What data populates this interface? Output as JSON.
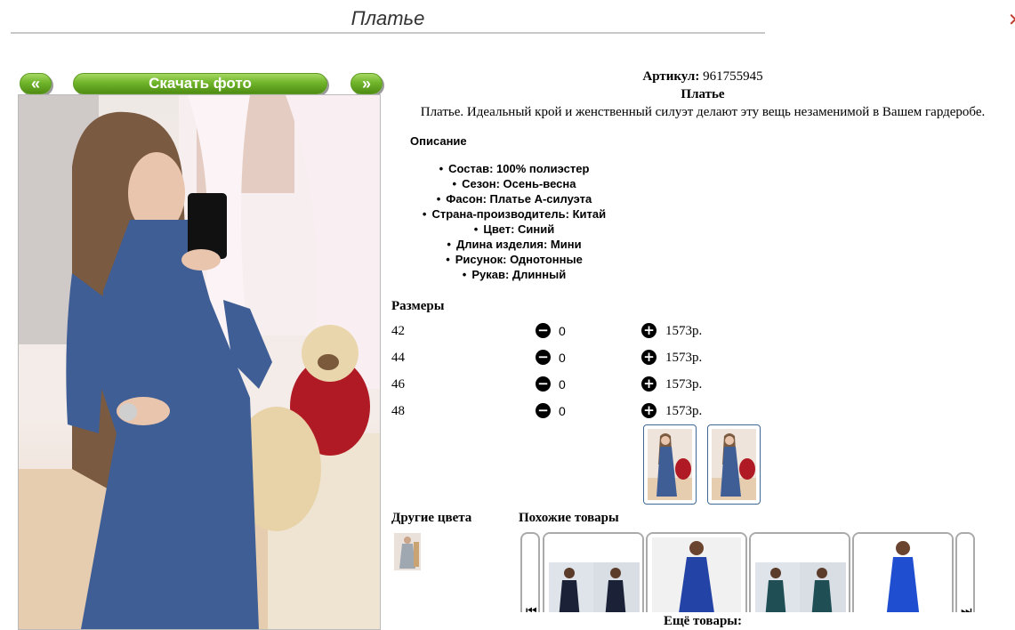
{
  "header": {
    "title": "Платье",
    "close_glyph": "✕"
  },
  "gallery": {
    "prev_label": "«",
    "download_label": "Скачать фото",
    "next_label": "»"
  },
  "product": {
    "article_label": "Артикул:",
    "article_value": "961755945",
    "name": "Платье",
    "description": "Платье. Идеальный крой и женственный силуэт делают эту вещь незаменимой в Вашем гардеробе.",
    "description_title": "Описание",
    "specs": [
      "Состав: 100% полиэстер",
      "Сезон: Осень-весна",
      "Фасон: Платье А-силуэта",
      "Страна-производитель: Китай",
      "Цвет: Синий",
      "Длина изделия: Мини",
      "Рисунок: Однотонные",
      "Рукав: Длинный"
    ]
  },
  "sizes": {
    "title": "Размеры",
    "minus_glyph": "−",
    "plus_glyph": "+",
    "rows": [
      {
        "size": "42",
        "qty": "0",
        "price": "1573р."
      },
      {
        "size": "44",
        "qty": "0",
        "price": "1573р."
      },
      {
        "size": "46",
        "qty": "0",
        "price": "1573р."
      },
      {
        "size": "48",
        "qty": "0",
        "price": "1573р."
      }
    ]
  },
  "other_colors": {
    "title": "Другие цвета"
  },
  "similar": {
    "title": "Похожие товары",
    "left_arrow": "⏮",
    "right_arrow": "⏭"
  },
  "more": {
    "label": "Ещё товары:"
  },
  "colors": {
    "button_green": "#70b52a",
    "dress_blue": "#3f5e95",
    "thumb_border": "#3f6896"
  }
}
